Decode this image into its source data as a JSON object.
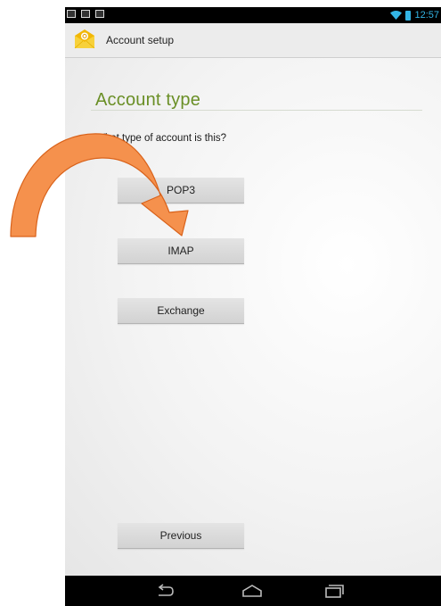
{
  "status_bar": {
    "time": "12:57",
    "accent_color": "#33b5e5",
    "notification_icons": [
      "image-icon",
      "mail-icon",
      "download-icon"
    ]
  },
  "action_bar": {
    "title": "Account setup",
    "app_icon": "email-app-icon"
  },
  "screen": {
    "section_title": "Account type",
    "question": "What type of account is this?",
    "title_color": "#6a8f26",
    "options": [
      {
        "label": "POP3"
      },
      {
        "label": "IMAP"
      },
      {
        "label": "Exchange"
      }
    ],
    "previous_label": "Previous"
  },
  "navigation_bar": {
    "buttons": [
      "back-icon",
      "home-icon",
      "recent-apps-icon"
    ]
  },
  "annotation": {
    "type": "curved-arrow",
    "color": "#f5914d",
    "points_to": "IMAP"
  }
}
